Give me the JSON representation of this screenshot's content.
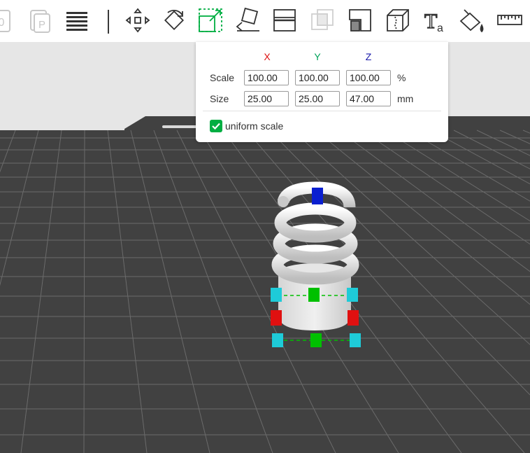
{
  "toolbar": {
    "icons": [
      "plate-icon",
      "profile-plate-icon",
      "layers-list-icon",
      "move-icon",
      "rotate-icon",
      "scale-icon",
      "lay-on-face-icon",
      "cut-icon",
      "boolean-icon",
      "support-paint-icon",
      "seam-paint-icon",
      "text-icon",
      "color-paint-icon",
      "measure-icon"
    ],
    "active": "scale-icon"
  },
  "scale_panel": {
    "axes": {
      "x": "X",
      "y": "Y",
      "z": "Z"
    },
    "axis_colors": {
      "x": "#dd1111",
      "y": "#00a35a",
      "z": "#1a1aaa"
    },
    "scale_label": "Scale",
    "size_label": "Size",
    "scale_values": {
      "x": "100.00",
      "y": "100.00",
      "z": "100.00"
    },
    "size_values": {
      "x": "25.00",
      "y": "25.00",
      "z": "47.00"
    },
    "scale_unit": "%",
    "size_unit": "mm",
    "uniform_scale_label": "uniform scale",
    "uniform_scale_checked": true
  },
  "colors": {
    "accent": "#00ae42",
    "plate": "#414141",
    "grid": "#6b6b6b",
    "handle_cyan": "#1ecbd8",
    "handle_green": "#00c000",
    "handle_red": "#e01010",
    "handle_blue": "#0a1fd0"
  }
}
